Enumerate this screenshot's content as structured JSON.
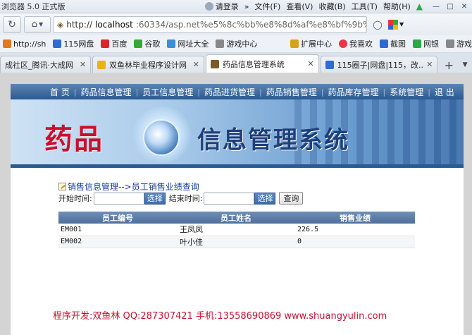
{
  "browser": {
    "title": "浏览器 5.0 正式版",
    "login": "请登录",
    "menus": [
      "文件(F)",
      "查看(V)",
      "收藏(B)",
      "工具(T)",
      "帮助(H)"
    ],
    "window_controls": [
      "—",
      "□",
      "✕"
    ]
  },
  "address": {
    "host": "localhost",
    "rest": ":60334/asp.net%e5%8c%bb%e8%8d%af%e8%bf%9b%e9"
  },
  "bookmarks": [
    {
      "label": "http://sh",
      "color": "#e07a1a"
    },
    {
      "label": "115网盘",
      "color": "#2f6bd0"
    },
    {
      "label": "百度",
      "color": "#d23"
    },
    {
      "label": "谷歌",
      "color": "#3a3"
    },
    {
      "label": "网址大全",
      "color": "#3a8fd6"
    },
    {
      "label": "游戏中心",
      "color": "#888"
    }
  ],
  "bookmarks_right": [
    {
      "label": "扩展中心",
      "color": "#d7a21a"
    },
    {
      "label": "我喜欢",
      "color": "#e34"
    },
    {
      "label": "截图",
      "color": "#2f6bd0"
    },
    {
      "label": "网银",
      "color": "#2aa84a"
    },
    {
      "label": "游戏",
      "color": "#888"
    }
  ],
  "tabs": [
    {
      "label": "成社区_腾讯·大成网",
      "active": false,
      "color": "#c0c8d2"
    },
    {
      "label": "双鱼林毕业程序设计网 [...",
      "active": false,
      "color": "#e7b21c"
    },
    {
      "label": "药品信息管理系统",
      "active": true,
      "color": "#7a5a2a"
    },
    {
      "label": "115圈子|网盘|115，改...",
      "active": false,
      "color": "#2f6bd0"
    }
  ],
  "nav": [
    "首 页",
    "药品信息管理",
    "员工信息管理",
    "药品进货管理",
    "药品销售管理",
    "药品库存管理",
    "系统管理",
    "退 出"
  ],
  "banner": {
    "title_red": "药品",
    "title_blue": "信息管理系统"
  },
  "breadcrumb": "销售信息管理-->员工销售业绩查询",
  "search": {
    "start_label": "开始时间:",
    "end_label": "结束时间:",
    "start_value": "",
    "end_value": "",
    "select_label": "选择",
    "query_label": "查询"
  },
  "table": {
    "headers": [
      "员工编号",
      "员工姓名",
      "销售业绩"
    ],
    "rows": [
      [
        "EM001",
        "王凤凤",
        "226.5"
      ],
      [
        "EM002",
        "叶小佳",
        "0"
      ]
    ]
  },
  "footer": "程序开发:双鱼林 QQ:287307421 手机:13558690869 www.shuangyulin.com"
}
